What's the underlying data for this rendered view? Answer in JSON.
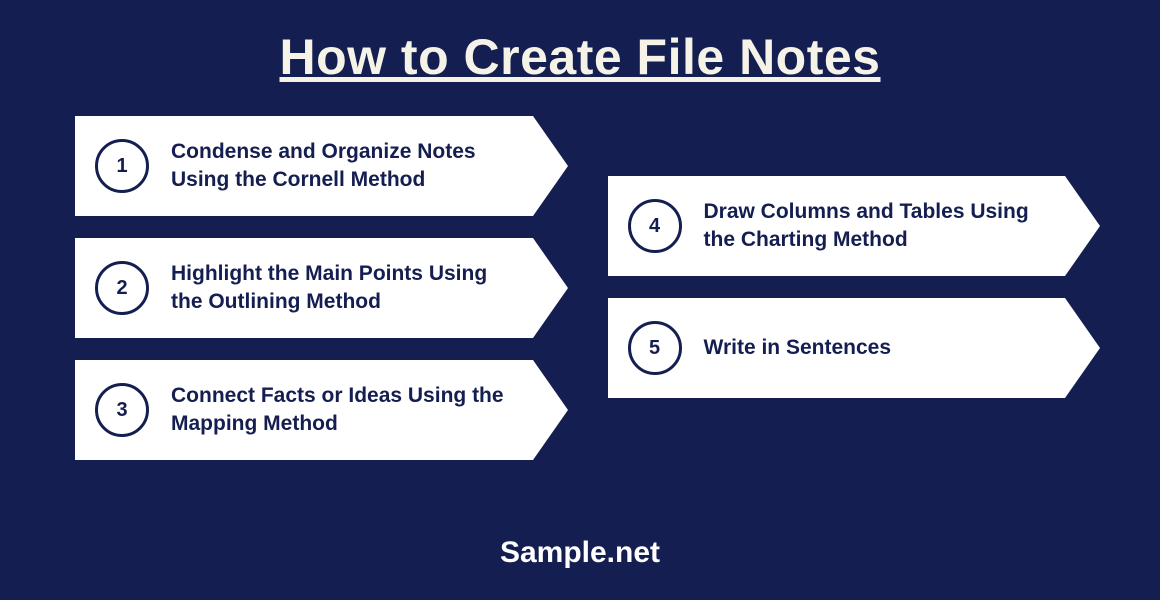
{
  "title": "How to Create File Notes",
  "footer": "Sample.net",
  "steps_left": [
    {
      "num": "1",
      "text": "Condense and Organize Notes Using the Cornell Method"
    },
    {
      "num": "2",
      "text": "Highlight the Main Points Using the Outlining Method"
    },
    {
      "num": "3",
      "text": "Connect Facts or Ideas Using the Mapping Method"
    }
  ],
  "steps_right": [
    {
      "num": "4",
      "text": "Draw Columns and Tables Using the Charting Method"
    },
    {
      "num": "5",
      "text": "Write in Sentences"
    }
  ]
}
